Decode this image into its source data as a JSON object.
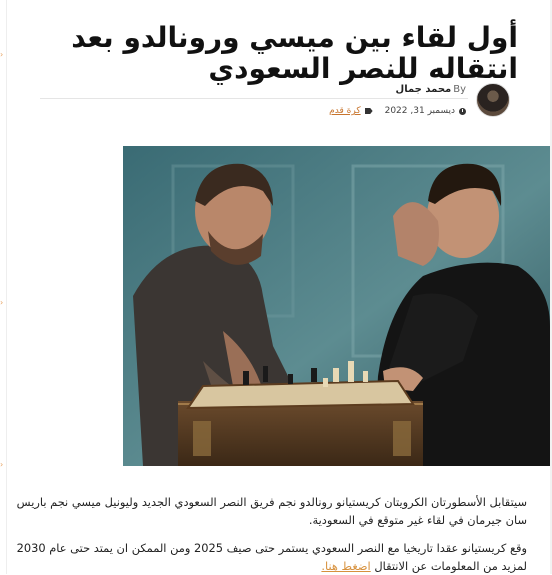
{
  "article": {
    "title": "أول لقاء بين ميسي ورونالدو بعد انتقاله للنصر السعودي",
    "author": {
      "prefix": "By",
      "name": "محمد جمال"
    },
    "date": "ديسمبر 31, 2022",
    "category": "كرة قدم",
    "paragraphs": {
      "p1": "سيتقابل الأسطورتان الكرويتان كريستيانو رونالدو نجم فريق النصر السعودي الجديد وليونيل ميسي نجم باريس سان جيرمان في لقاء غير متوقع في السعودية.",
      "p2_text": "وقع كريستيانو عقدا تاريخيا مع النصر السعودي يستمر حتى صيف 2025 ومن الممكن ان يمتد حتى عام 2030 لمزيد من المعلومات عن الانتقال",
      "p2_link": "اضغط هنا."
    }
  },
  "icons": {
    "clock": "clock-icon",
    "tag": "tag-icon",
    "avatar": "author-avatar"
  },
  "colors": {
    "accent": "#c8752e",
    "link": "#d7913d",
    "text": "#222222"
  }
}
